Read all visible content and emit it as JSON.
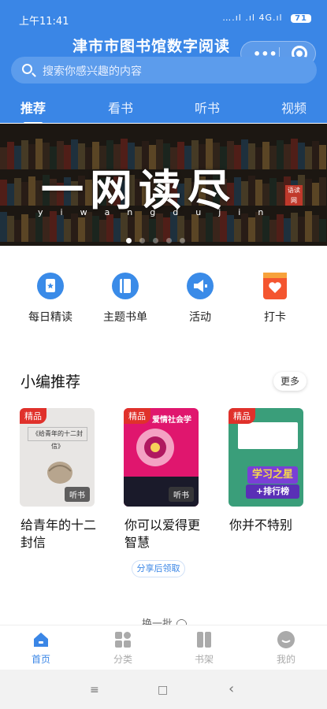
{
  "status": {
    "time": "上午11:41",
    "signal": "….ıl .ıl 4G.ıl",
    "battery": "71"
  },
  "header": {
    "title": "津市市图书馆数字阅读"
  },
  "search": {
    "placeholder": "搜索你感兴趣的内容"
  },
  "tabs": [
    {
      "label": "推荐",
      "active": true
    },
    {
      "label": "看书"
    },
    {
      "label": "听书"
    },
    {
      "label": "视频"
    }
  ],
  "banner": {
    "calligraphy": "一网读尽",
    "pinyin": "yiwangdujin",
    "seal": "语读网"
  },
  "quick_links": [
    {
      "label": "每日精读",
      "icon": "book-star-icon"
    },
    {
      "label": "主题书单",
      "icon": "book-list-icon"
    },
    {
      "label": "活动",
      "icon": "megaphone-icon"
    },
    {
      "label": "打卡",
      "icon": "heart-calendar-icon"
    }
  ],
  "section": {
    "title": "小编推荐",
    "more": "更多"
  },
  "books": [
    {
      "badge": "精品",
      "title": "给青年的十二封信",
      "cover_text": "《给青年的十二封信》",
      "tag": "听书",
      "cover_color": "#e8e6e4"
    },
    {
      "badge": "精品",
      "title": "你可以爱得更智慧",
      "cover_text": "爱情社会学",
      "tag": "听书",
      "cover_color": "#e0166e"
    },
    {
      "badge": "精品",
      "title": "你并不特别",
      "cover_text": "学习之星",
      "cover_text2": "+排行榜",
      "cover_color": "#3a9e7a"
    }
  ],
  "share_label": "分享后领取",
  "refresh_label": "换一批 ◯",
  "tabbar": [
    {
      "label": "首页",
      "icon": "home-icon",
      "active": true
    },
    {
      "label": "分类",
      "icon": "grid-icon"
    },
    {
      "label": "书架",
      "icon": "bookshelf-icon"
    },
    {
      "label": "我的",
      "icon": "profile-icon"
    }
  ],
  "sysnav": {
    "menu": "≡",
    "home": "□",
    "back": "‹"
  }
}
